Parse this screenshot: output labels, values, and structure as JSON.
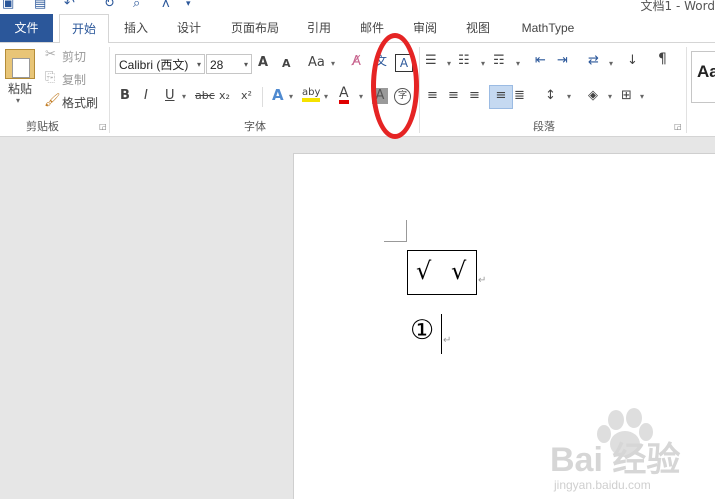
{
  "titlebar": {
    "title": "文档1 - Word",
    "quick_access": [
      "word-logo-icon",
      "save-icon",
      "undo-icon",
      "redo-icon",
      "print-preview-icon",
      "format-icon",
      "customize-icon"
    ]
  },
  "tabs": [
    "文件",
    "开始",
    "插入",
    "设计",
    "页面布局",
    "引用",
    "邮件",
    "审阅",
    "视图",
    "MathType"
  ],
  "ribbon": {
    "clipboard": {
      "paste_label": "粘贴",
      "cut_label": "剪切",
      "copy_label": "复制",
      "format_painter_label": "格式刷",
      "group_label": "剪贴板"
    },
    "font": {
      "font_name": "Calibri (西文)",
      "font_size": "28",
      "grow_label": "A",
      "shrink_label": "A",
      "case_label": "Aa",
      "bold": "B",
      "italic": "I",
      "underline": "U",
      "strike": "abc",
      "subscript": "x₂",
      "superscript": "x²",
      "text_effects": "A",
      "highlight": "aby",
      "font_color": "A",
      "char_shading": "A",
      "enclose_char": "字",
      "phonetic": "文",
      "char_border": "A",
      "group_label": "字体"
    },
    "paragraph": {
      "group_label": "段落"
    },
    "styles": {
      "preview": "Aa"
    }
  },
  "document": {
    "check1": "√",
    "check2": "√",
    "circled_char": "①"
  },
  "watermark": {
    "line1": "Bai 经验",
    "line2": "jingyan.baidu.com"
  }
}
